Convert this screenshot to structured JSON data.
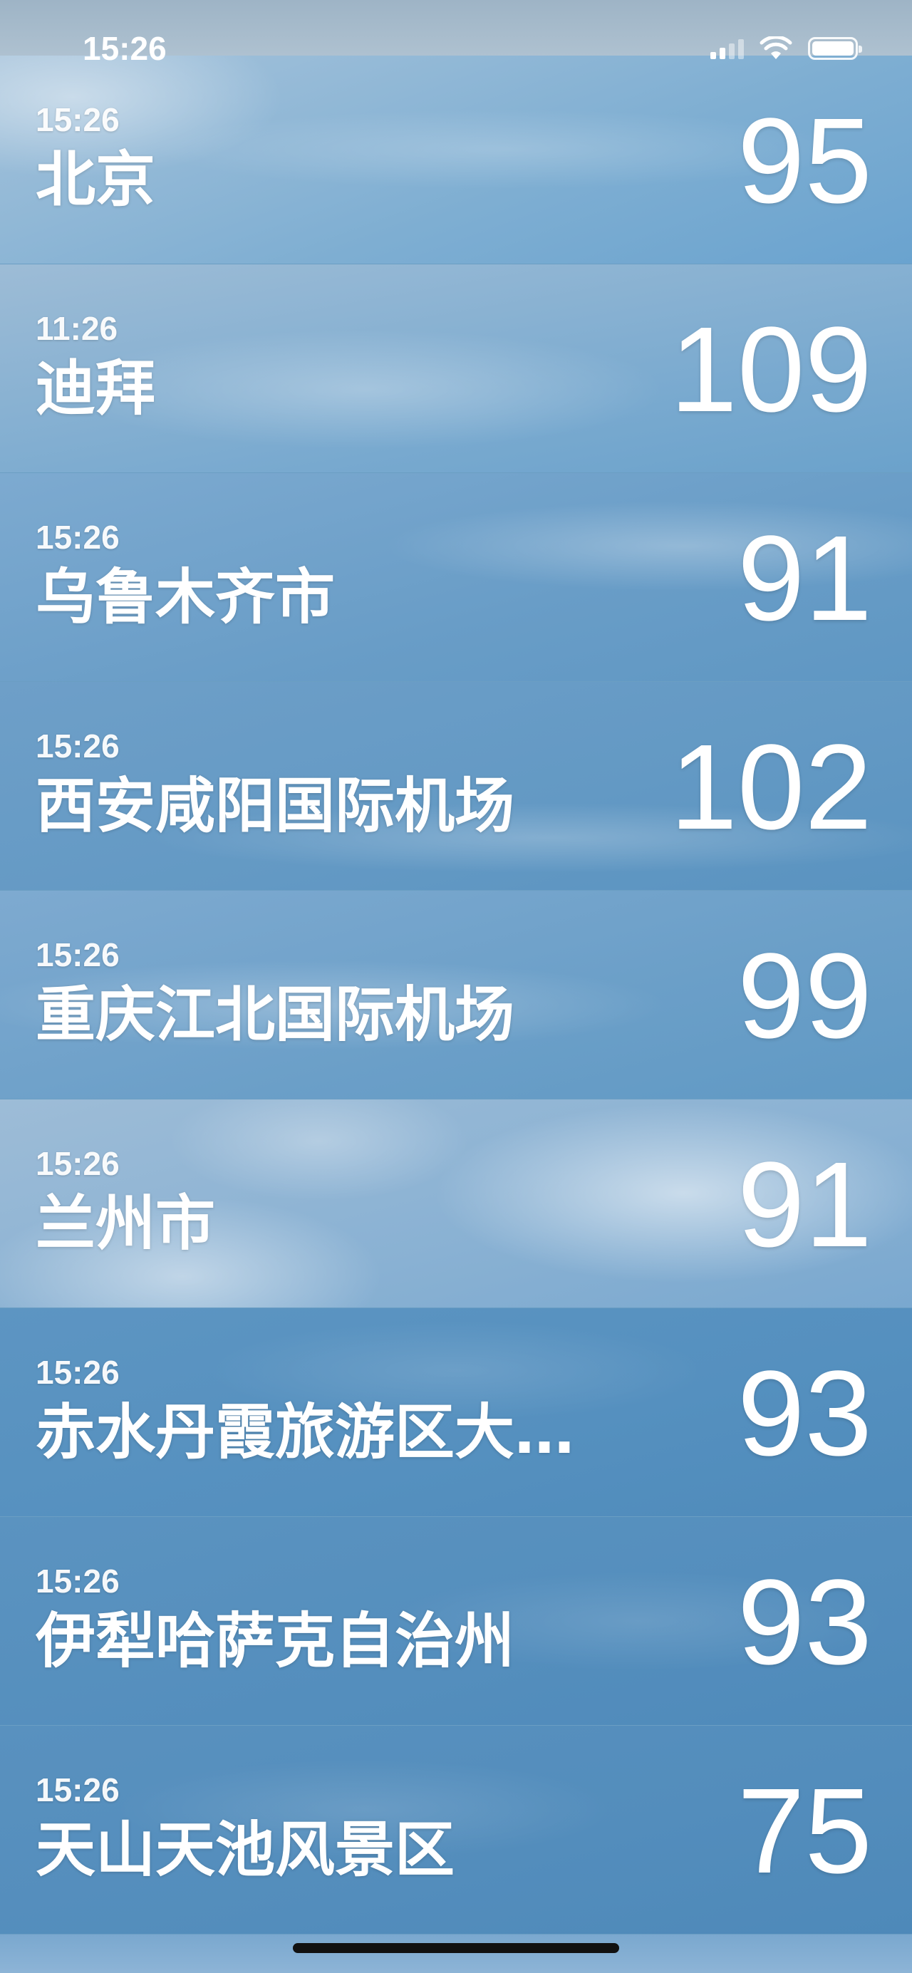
{
  "status_bar": {
    "time": "15:26",
    "icons": [
      "cellular-signal-icon",
      "wifi-icon",
      "battery-icon"
    ]
  },
  "cities": [
    {
      "time": "15:26",
      "name": "北京",
      "value": "95"
    },
    {
      "time": "11:26",
      "name": "迪拜",
      "value": "109"
    },
    {
      "time": "15:26",
      "name": "乌鲁木齐市",
      "value": "91"
    },
    {
      "time": "15:26",
      "name": "西安咸阳国际机场",
      "value": "102"
    },
    {
      "time": "15:26",
      "name": "重庆江北国际机场",
      "value": "99"
    },
    {
      "time": "15:26",
      "name": "兰州市",
      "value": "91"
    },
    {
      "time": "15:26",
      "name": "赤水丹霞旅游区大…",
      "value": "93"
    },
    {
      "time": "15:26",
      "name": "伊犁哈萨克自治州",
      "value": "93"
    },
    {
      "time": "15:26",
      "name": "天山天池风景区",
      "value": "75"
    }
  ],
  "colors": {
    "text": "#ffffff",
    "sky_top": "#a6c3db",
    "sky_bottom": "#4f8aba"
  }
}
